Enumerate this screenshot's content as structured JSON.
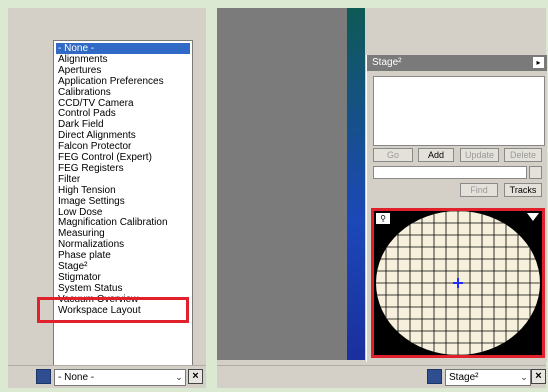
{
  "left_window": {
    "dropdown_items": [
      "- None -",
      "Alignments",
      "Apertures",
      "Application Preferences",
      "Calibrations",
      "CCD/TV Camera",
      "Control Pads",
      "Dark Field",
      "Direct Alignments",
      "Falcon Protector",
      "FEG Control (Expert)",
      "FEG Registers",
      "Filter",
      "High Tension",
      "Image Settings",
      "Low Dose",
      "Magnification Calibration",
      "Measuring",
      "Normalizations",
      "Phase plate",
      "Stage²",
      "Stigmator",
      "System Status",
      "Vacuum Overview",
      "Workspace Layout"
    ],
    "selected_index": 0,
    "highlighted_item": "Stage²",
    "combo_value": "- None -"
  },
  "right_window": {
    "stage_panel": {
      "title": "Stage²",
      "buttons": {
        "go": "Go",
        "add": "Add",
        "update": "Update",
        "delete": "Delete",
        "find": "Find",
        "tracks": "Tracks"
      }
    },
    "combo_value": "Stage²"
  },
  "colors": {
    "highlight_red": "#e0202a",
    "selection_blue": "#3169c6",
    "map_disk": "#f7f0dc",
    "marker_blue": "#1f2cff"
  },
  "icons": {
    "combo_arrow": "chevron-down-icon",
    "close": "close-icon",
    "map_zoom": "zoom-icon",
    "map_menu": "triangle-down-icon",
    "center_marker": "crosshair-icon"
  }
}
